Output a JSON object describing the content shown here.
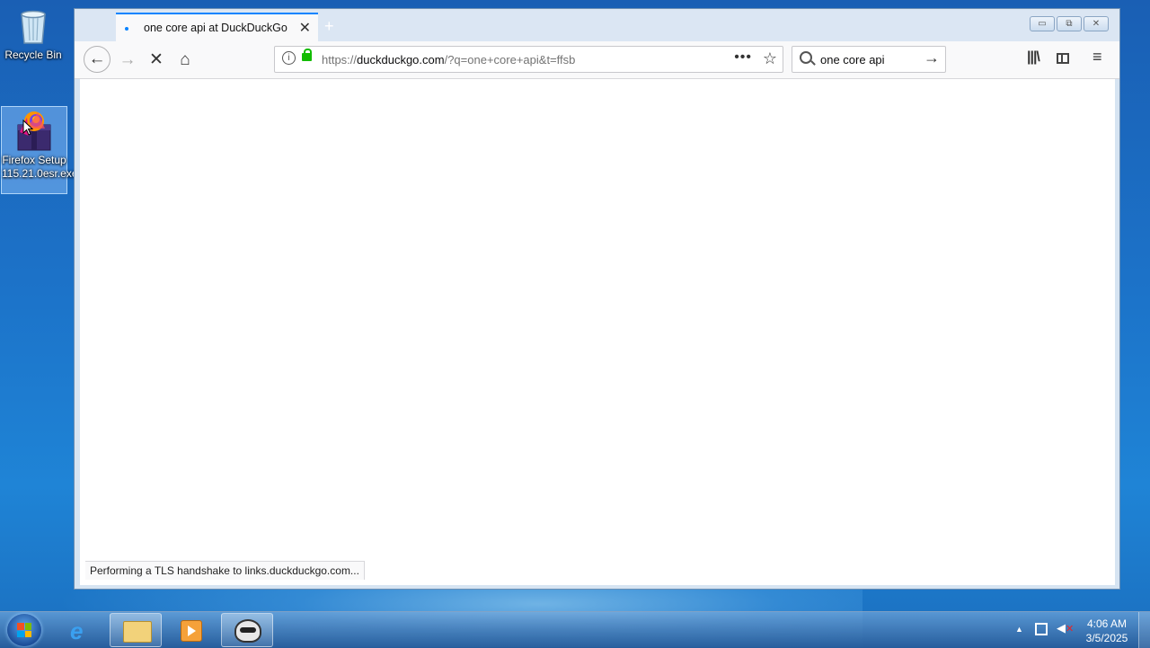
{
  "desktop": {
    "icons": [
      {
        "label": "Recycle Bin",
        "icon": "recycle-bin-icon"
      },
      {
        "label": "Firefox Setup 115.21.0esr.exe",
        "icon": "firefox-installer-icon"
      }
    ]
  },
  "browser": {
    "tab": {
      "title": "one core api at DuckDuckGo",
      "favicon": "duckduckgo-icon"
    },
    "new_tab_symbol": "+",
    "window_controls": {
      "minimize": "▭",
      "restore": "⧉",
      "close": "✕"
    },
    "nav": {
      "back": "←",
      "forward": "→",
      "stop": "✕",
      "home": "⌂"
    },
    "url": {
      "prefix": "https://",
      "domain": "duckduckgo.com",
      "rest": "/?q=one+core+api&t=ffsb"
    },
    "page_actions": "•••",
    "bookmark_symbol": "☆",
    "search": {
      "query": "one core api",
      "go": "→"
    },
    "toolbar": {
      "library": "|||\\",
      "menu": "≡"
    },
    "status_text": "Performing a TLS handshake to links.duckduckgo.com..."
  },
  "taskbar": {
    "clock_time": "4:06 AM",
    "clock_date": "3/5/2025",
    "tray_arrow": "▲",
    "items": [
      "start-button",
      "internet-explorer",
      "windows-explorer",
      "media-player",
      "firefox-installer"
    ]
  },
  "colors": {
    "accent": "#0a84ff",
    "secure": "#12bc00"
  }
}
